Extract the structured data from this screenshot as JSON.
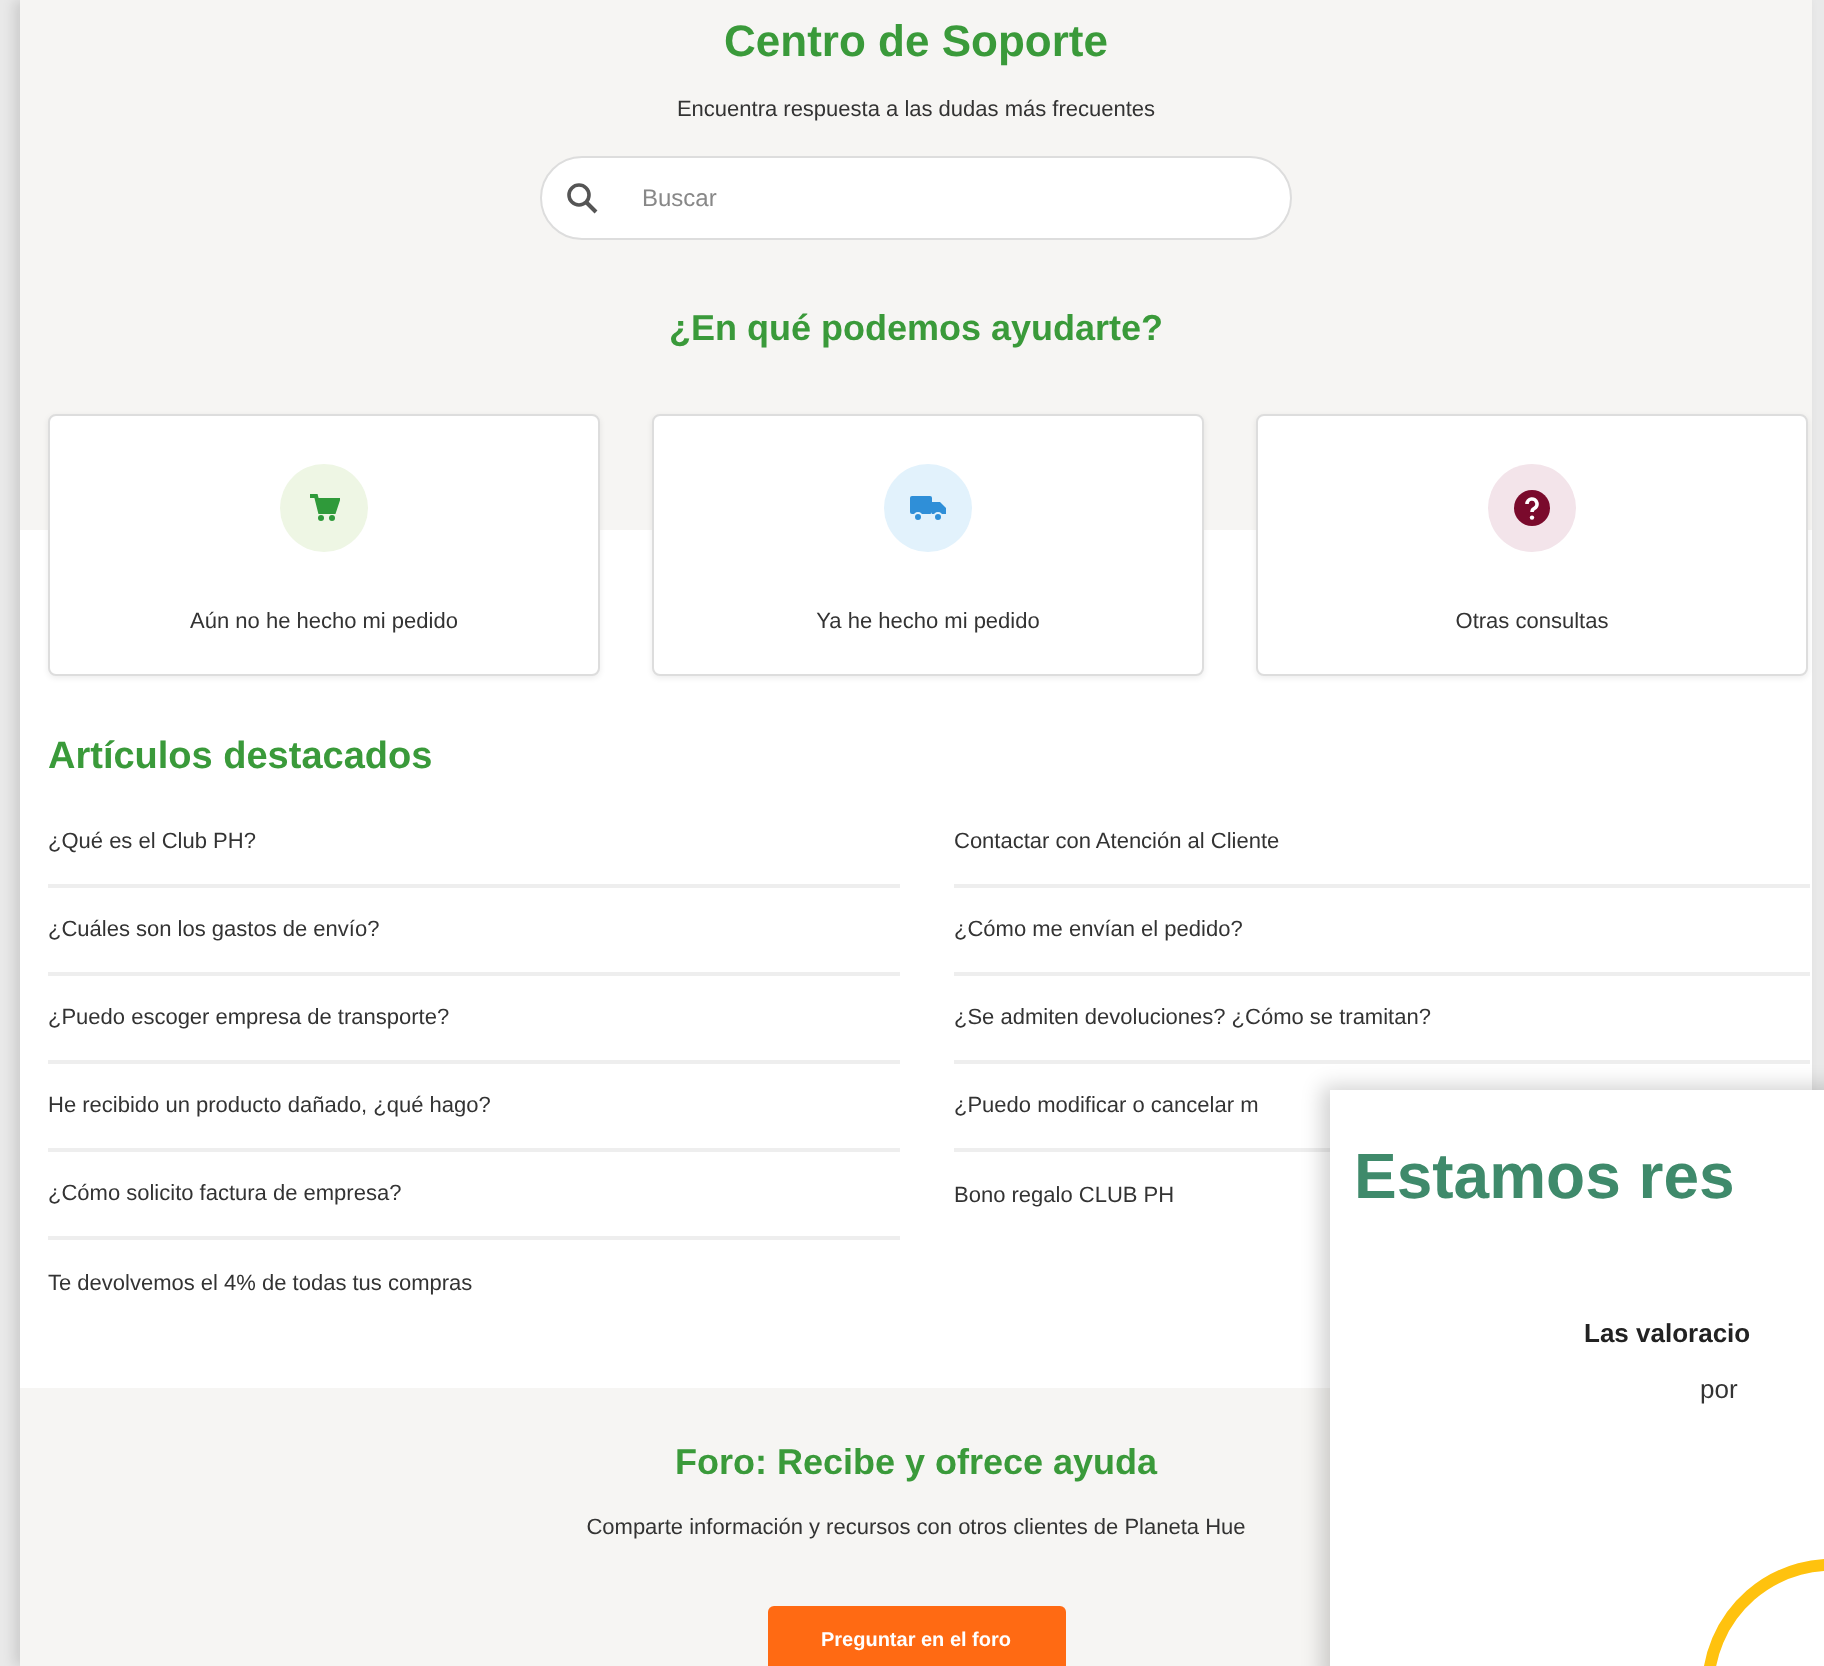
{
  "header": {
    "title": "Centro de Soporte",
    "subtitle": "Encuentra respuesta a las dudas más frecuentes",
    "search": {
      "placeholder": "Buscar"
    }
  },
  "help": {
    "title": "¿En qué podemos ayudarte?",
    "cards": [
      {
        "kind": "cart",
        "label": "Aún no he hecho mi pedido"
      },
      {
        "kind": "truck",
        "label": "Ya he hecho mi pedido"
      },
      {
        "kind": "question",
        "label": "Otras consultas"
      }
    ]
  },
  "articles": {
    "title": "Artículos destacados",
    "left": [
      "¿Qué es el Club PH?",
      "¿Cuáles son los gastos de envío?",
      "¿Puedo escoger empresa de transporte?",
      "He recibido un producto dañado, ¿qué hago?",
      "¿Cómo solicito factura de empresa?",
      "Te devolvemos el 4% de todas tus compras"
    ],
    "right": [
      "Contactar con Atención al Cliente",
      "¿Cómo me envían el pedido?",
      "¿Se admiten devoluciones? ¿Cómo se tramitan?",
      "¿Puedo modificar o cancelar m",
      "Bono regalo CLUB PH"
    ]
  },
  "forum": {
    "title": "Foro: Recibe y ofrece ayuda",
    "text": "Comparte información y recursos con otros clientes de Planeta Hue",
    "button": "Preguntar en el foro"
  },
  "popup": {
    "title": "Estamos res",
    "line_1": "Las valoracio",
    "line_2": "por"
  }
}
